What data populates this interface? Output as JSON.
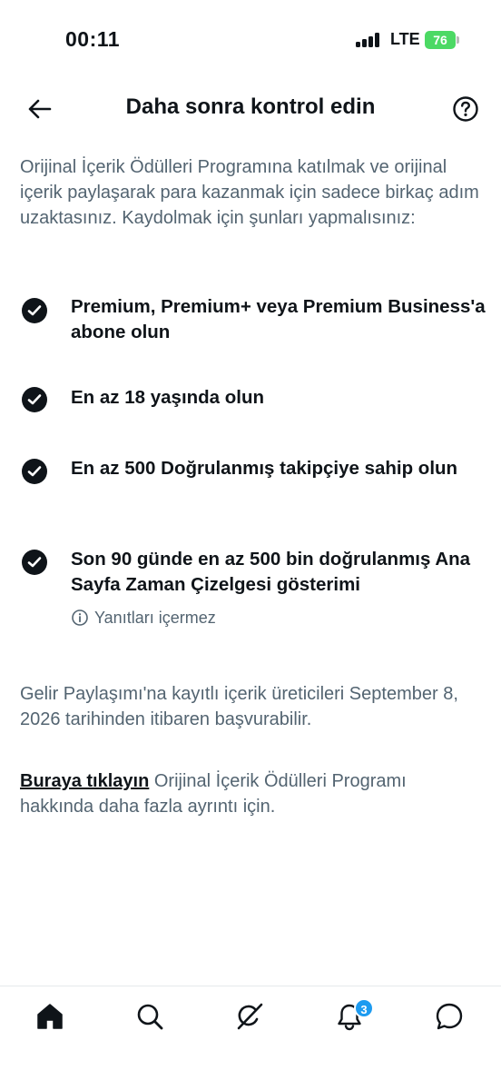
{
  "status_bar": {
    "time": "00:11",
    "network": "LTE",
    "battery": "76"
  },
  "header": {
    "title": "Daha sonra kontrol edin",
    "back_icon": "arrow-left-icon",
    "help_icon": "question-circle-icon"
  },
  "intro": "Orijinal İçerik Ödülleri Programına katılmak ve orijinal içerik paylaşarak para kazanmak için sadece birkaç adım uzaktasınız. Kaydolmak için şunları yapmalısınız:",
  "requirements": [
    {
      "text": "Premium, Premium+ veya Premium Business'a abone olun",
      "completed": true
    },
    {
      "text": "En az 18 yaşında olun",
      "completed": true
    },
    {
      "text": "En az 500 Doğrulanmış takipçiye sahip olun",
      "completed": true
    },
    {
      "text": "Son 90 günde en az 500 bin doğrulanmış Ana Sayfa Zaman Çizelgesi gösterimi",
      "completed": true,
      "note": "Yanıtları içermez"
    }
  ],
  "revenue_share_text": "Gelir Paylaşımı'na kayıtlı içerik üreticileri September 8, 2026 tarihinden itibaren başvurabilir.",
  "more_info": {
    "link_text": "Buraya tıklayın",
    "text": " Orijinal İçerik Ödülleri Programı hakkında daha fazla ayrıntı için."
  },
  "bottom_nav": {
    "items": [
      "home-icon",
      "search-icon",
      "grok-icon",
      "notifications-icon",
      "messages-icon"
    ],
    "notifications_badge": "3"
  },
  "colors": {
    "primary_text": "#0f1419",
    "secondary_text": "#536471",
    "badge": "#1d9bf0",
    "battery": "#4cd964"
  }
}
